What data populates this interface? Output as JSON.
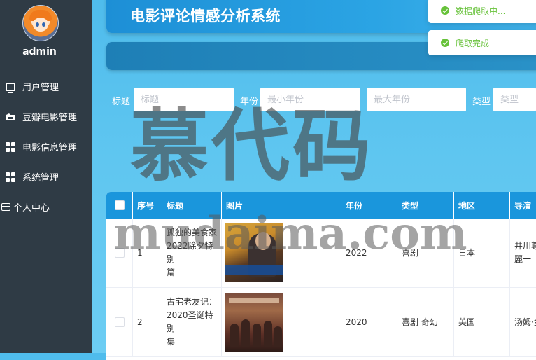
{
  "app": {
    "title": "电影评论情感分析系统"
  },
  "sidebar": {
    "username": "admin",
    "items": [
      {
        "label": "用户管理",
        "icon": "monitor-icon"
      },
      {
        "label": "豆瓣电影管理",
        "icon": "folder-icon"
      },
      {
        "label": "电影信息管理",
        "icon": "grid-icon"
      },
      {
        "label": "系统管理",
        "icon": "grid-icon"
      },
      {
        "label": "个人中心",
        "icon": "card-icon"
      }
    ]
  },
  "toasts": [
    {
      "text": "数据爬取中..."
    },
    {
      "text": "爬取完成"
    }
  ],
  "search": {
    "title_label": "标题",
    "title_placeholder": "标题",
    "year_label": "年份",
    "min_year_placeholder": "最小年份",
    "max_year_placeholder": "最大年份",
    "type_label": "类型",
    "type_placeholder": "类型"
  },
  "table": {
    "headers": [
      "序号",
      "标题",
      "图片",
      "年份",
      "类型",
      "地区",
      "导演"
    ],
    "rows": [
      {
        "index": "1",
        "title": "孤独的美食家2022除夕特别篇",
        "title_lines": [
          "孤独的美食家",
          "2022除夕特别",
          "篇"
        ],
        "year": "2022",
        "genre": "喜剧",
        "region": "日本",
        "director_lines": [
          "井川尊",
          "麗一"
        ]
      },
      {
        "index": "2",
        "title": "古宅老友记：2020圣诞特别集",
        "title_lines": [
          "古宅老友记：",
          "2020圣诞特别",
          "集"
        ],
        "year": "2020",
        "genre": "喜剧 奇幻",
        "region": "英国",
        "director_lines": [
          "汤姆·金"
        ]
      }
    ]
  },
  "watermark": {
    "cn": "慕代码",
    "en": "mudaima.com"
  },
  "colors": {
    "sidebar_bg": "#2f3b45",
    "header_bg": "#1d8fd6",
    "table_header_bg": "#1a96dc",
    "success_green": "#67c23a"
  }
}
